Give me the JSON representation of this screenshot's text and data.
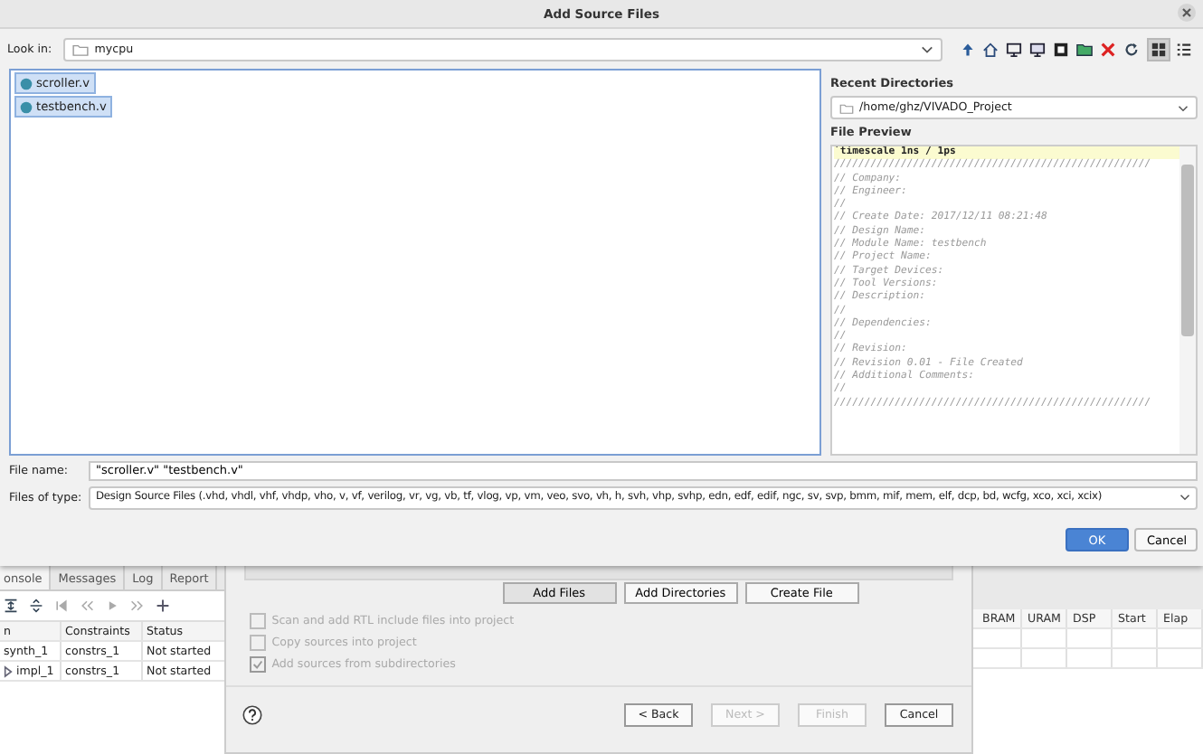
{
  "dialog": {
    "title": "Add Source Files",
    "look_in": {
      "label": "Look in:",
      "value": "mycpu"
    },
    "view_modes": [
      {
        "kind": "grid",
        "selected": true
      },
      {
        "kind": "list",
        "selected": false
      }
    ],
    "files": [
      {
        "name": "scroller.v",
        "selected": true
      },
      {
        "name": "testbench.v",
        "selected": true
      }
    ],
    "recent_directories": {
      "label": "Recent Directories",
      "value": "/home/ghz/VIVADO_Project"
    },
    "file_preview": {
      "label": "File Preview",
      "lines": [
        {
          "kind": "directive",
          "text": "`timescale 1ns / 1ps"
        },
        {
          "kind": "comment",
          "text": "////////////////////////////////////////////////////"
        },
        {
          "kind": "comment",
          "text": "// Company:"
        },
        {
          "kind": "comment",
          "text": "// Engineer:"
        },
        {
          "kind": "comment",
          "text": "//"
        },
        {
          "kind": "comment",
          "text": "// Create Date: 2017/12/11 08:21:48"
        },
        {
          "kind": "comment",
          "text": "// Design Name:"
        },
        {
          "kind": "comment",
          "text": "// Module Name: testbench"
        },
        {
          "kind": "comment",
          "text": "// Project Name:"
        },
        {
          "kind": "comment",
          "text": "// Target Devices:"
        },
        {
          "kind": "comment",
          "text": "// Tool Versions:"
        },
        {
          "kind": "comment",
          "text": "// Description:"
        },
        {
          "kind": "comment",
          "text": "//"
        },
        {
          "kind": "comment",
          "text": "// Dependencies:"
        },
        {
          "kind": "comment",
          "text": "//"
        },
        {
          "kind": "comment",
          "text": "// Revision:"
        },
        {
          "kind": "comment",
          "text": "// Revision 0.01 - File Created"
        },
        {
          "kind": "comment",
          "text": "// Additional Comments:"
        },
        {
          "kind": "comment",
          "text": "//"
        },
        {
          "kind": "comment",
          "text": "////////////////////////////////////////////////////"
        }
      ]
    },
    "file_name": {
      "label": "File name:",
      "value": "\"scroller.v\" \"testbench.v\""
    },
    "files_of_type": {
      "label": "Files of type:",
      "value": "Design Source Files (.vhd, vhdl, vhf, vhdp, vho, v, vf, verilog, vr, vg, vb, tf, vlog, vp, vm, veo, svo, vh, h, svh, vhp, svhp, edn, edf, edif, ngc, sv, svp, bmm, mif, mem, elf, dcp, bd, wcfg, xco, xci, xcix)"
    },
    "buttons": [
      {
        "label": "OK",
        "kind": "primary"
      },
      {
        "label": "Cancel",
        "kind": "normal"
      }
    ]
  },
  "background": {
    "tabs": [
      {
        "label": "onsole",
        "selected": true
      },
      {
        "label": "Messages",
        "selected": false
      },
      {
        "label": "Log",
        "selected": false
      },
      {
        "label": "Report",
        "selected": false
      }
    ],
    "runs_table": {
      "columns": [
        "n",
        "Constraints",
        "Status"
      ],
      "rows": [
        {
          "name": "synth_1",
          "expandable": false,
          "constraints": "constrs_1",
          "status": "Not started"
        },
        {
          "name": "impl_1",
          "expandable": true,
          "constraints": "constrs_1",
          "status": "Not started"
        }
      ]
    },
    "wizard": {
      "actions": [
        "Add Files",
        "Add Directories",
        "Create File"
      ],
      "options": [
        {
          "label": "Scan and add RTL include files into project",
          "checked": false,
          "disabled": true
        },
        {
          "label": "Copy sources into project",
          "checked": false,
          "disabled": true
        },
        {
          "label": "Add sources from subdirectories",
          "checked": true,
          "disabled": true
        }
      ],
      "nav_buttons": [
        {
          "label": "< Back",
          "disabled": false
        },
        {
          "label": "Next >",
          "disabled": true
        },
        {
          "label": "Finish",
          "disabled": true
        },
        {
          "label": "Cancel",
          "disabled": false
        }
      ]
    },
    "stats_columns": [
      "BRAM",
      "URAM",
      "DSP",
      "Start",
      "Elap"
    ]
  }
}
